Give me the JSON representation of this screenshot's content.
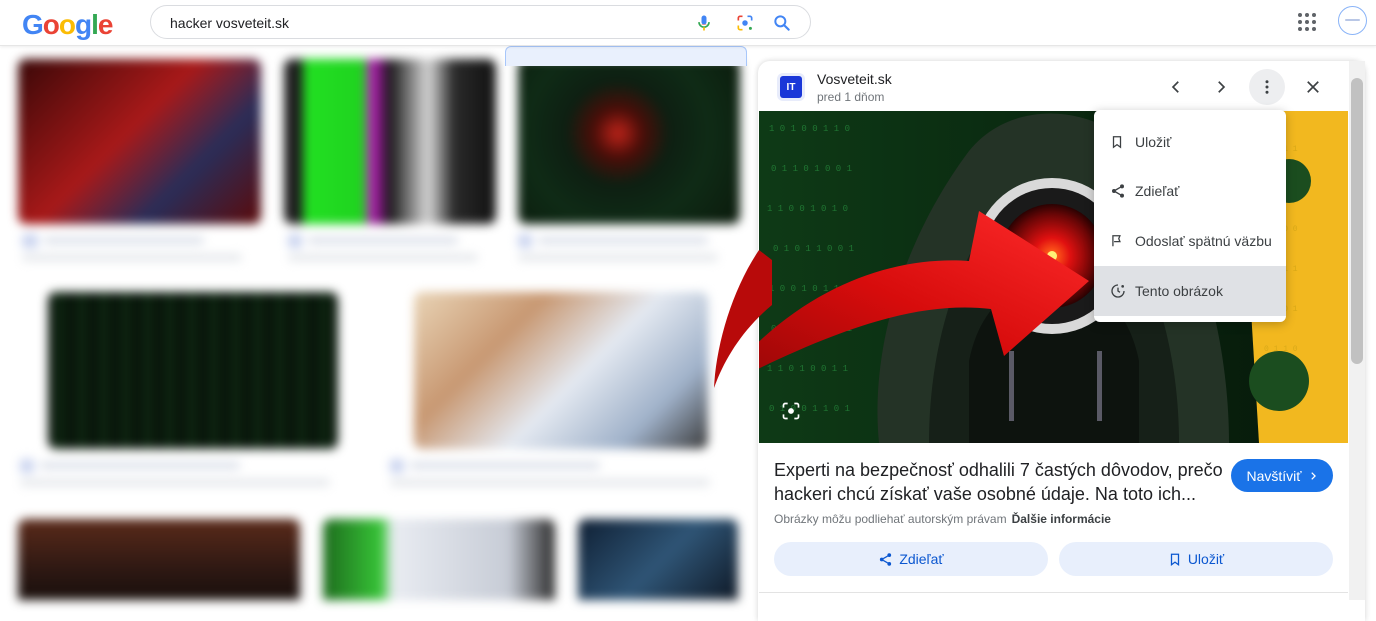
{
  "header": {
    "logo_text": "Google",
    "search_value": "hacker vosveteit.sk",
    "icons": [
      "mic-icon",
      "lens-icon",
      "search-icon",
      "apps-icon",
      "avatar"
    ]
  },
  "panel": {
    "source_favicon": "IT",
    "source_name": "Vosveteit.sk",
    "source_date": "pred 1 dňom",
    "title": "Experti na bezpečnosť odhalili 7 častých dôvodov, prečo hackeri chcú získať vaše osobné údaje. Na toto ich...",
    "visit_label": "Navštíviť",
    "copyright_text": "Obrázky môžu podliehať autorským právam",
    "more_info_label": "Ďalšie informácie",
    "share_label": "Zdieľať",
    "save_label": "Uložiť"
  },
  "menu": {
    "items": [
      {
        "label": "Uložiť",
        "icon": "bookmark-icon"
      },
      {
        "label": "Zdieľať",
        "icon": "share-icon"
      },
      {
        "label": "Odoslať spätnú väzbu",
        "icon": "flag-icon"
      },
      {
        "label": "Tento obrázok",
        "icon": "about-image-icon"
      }
    ],
    "highlighted_index": 3
  },
  "colors": {
    "accent": "#1a73e8",
    "chip_bg": "#e8effc",
    "arrow_red": "#d70c0c",
    "favicon_blue": "#1a37d8"
  }
}
